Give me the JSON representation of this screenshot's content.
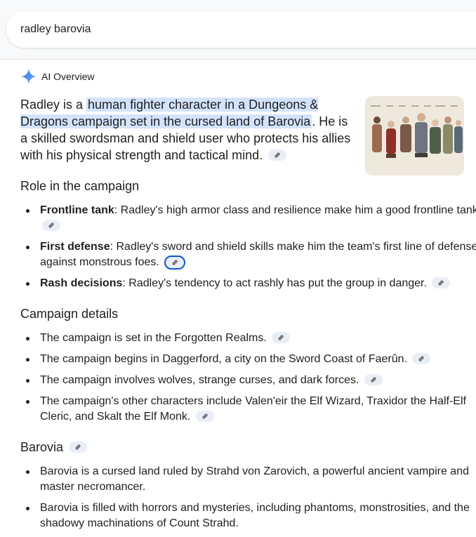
{
  "search": {
    "query": "radley barovia"
  },
  "ai_overview": {
    "label": "AI Overview"
  },
  "intro": {
    "prefix": "Radley is a ",
    "highlight": "human fighter character in a Dungeons & Dragons campaign set in the cursed land of Barovia",
    "suffix": ". He is a skilled swordsman and shield user who protects his allies with his physical strength and tactical mind."
  },
  "sections": {
    "role": {
      "heading": "Role in the campaign",
      "items": [
        {
          "term": "Frontline tank",
          "text": ": Radley's high armor class and resilience make him a good frontline tank."
        },
        {
          "term": "First defense",
          "text": ": Radley's sword and shield skills make him the team's first line of defense against monstrous foes."
        },
        {
          "term": "Rash decisions",
          "text": ": Radley's tendency to act rashly has put the group in danger."
        }
      ]
    },
    "campaign": {
      "heading": "Campaign details",
      "items": [
        "The campaign is set in the Forgotten Realms.",
        "The campaign begins in Daggerford, a city on the Sword Coast of Faerûn.",
        "The campaign involves wolves, strange curses, and dark forces.",
        "The campaign's other characters include Valen'eir the Elf Wizard, Traxidor the Half-Elf Cleric, and Skalt the Elf Monk."
      ]
    },
    "barovia": {
      "heading": "Barovia",
      "items": [
        "Barovia is a cursed land ruled by Strahd von Zarovich, a powerful ancient vampire and master necromancer.",
        "Barovia is filled with horrors and mysteries, including phantoms, monstrosities, and the shadowy machinations of Count Strahd."
      ]
    }
  },
  "colors": {
    "highlight": "#d3e3fd",
    "link_chip": "#e9eef6",
    "focus_ring": "#0b57d0",
    "gemini_blue": "#4285f4"
  },
  "icons": {
    "ai": "gemini-sparkle-icon",
    "link": "link-icon"
  }
}
